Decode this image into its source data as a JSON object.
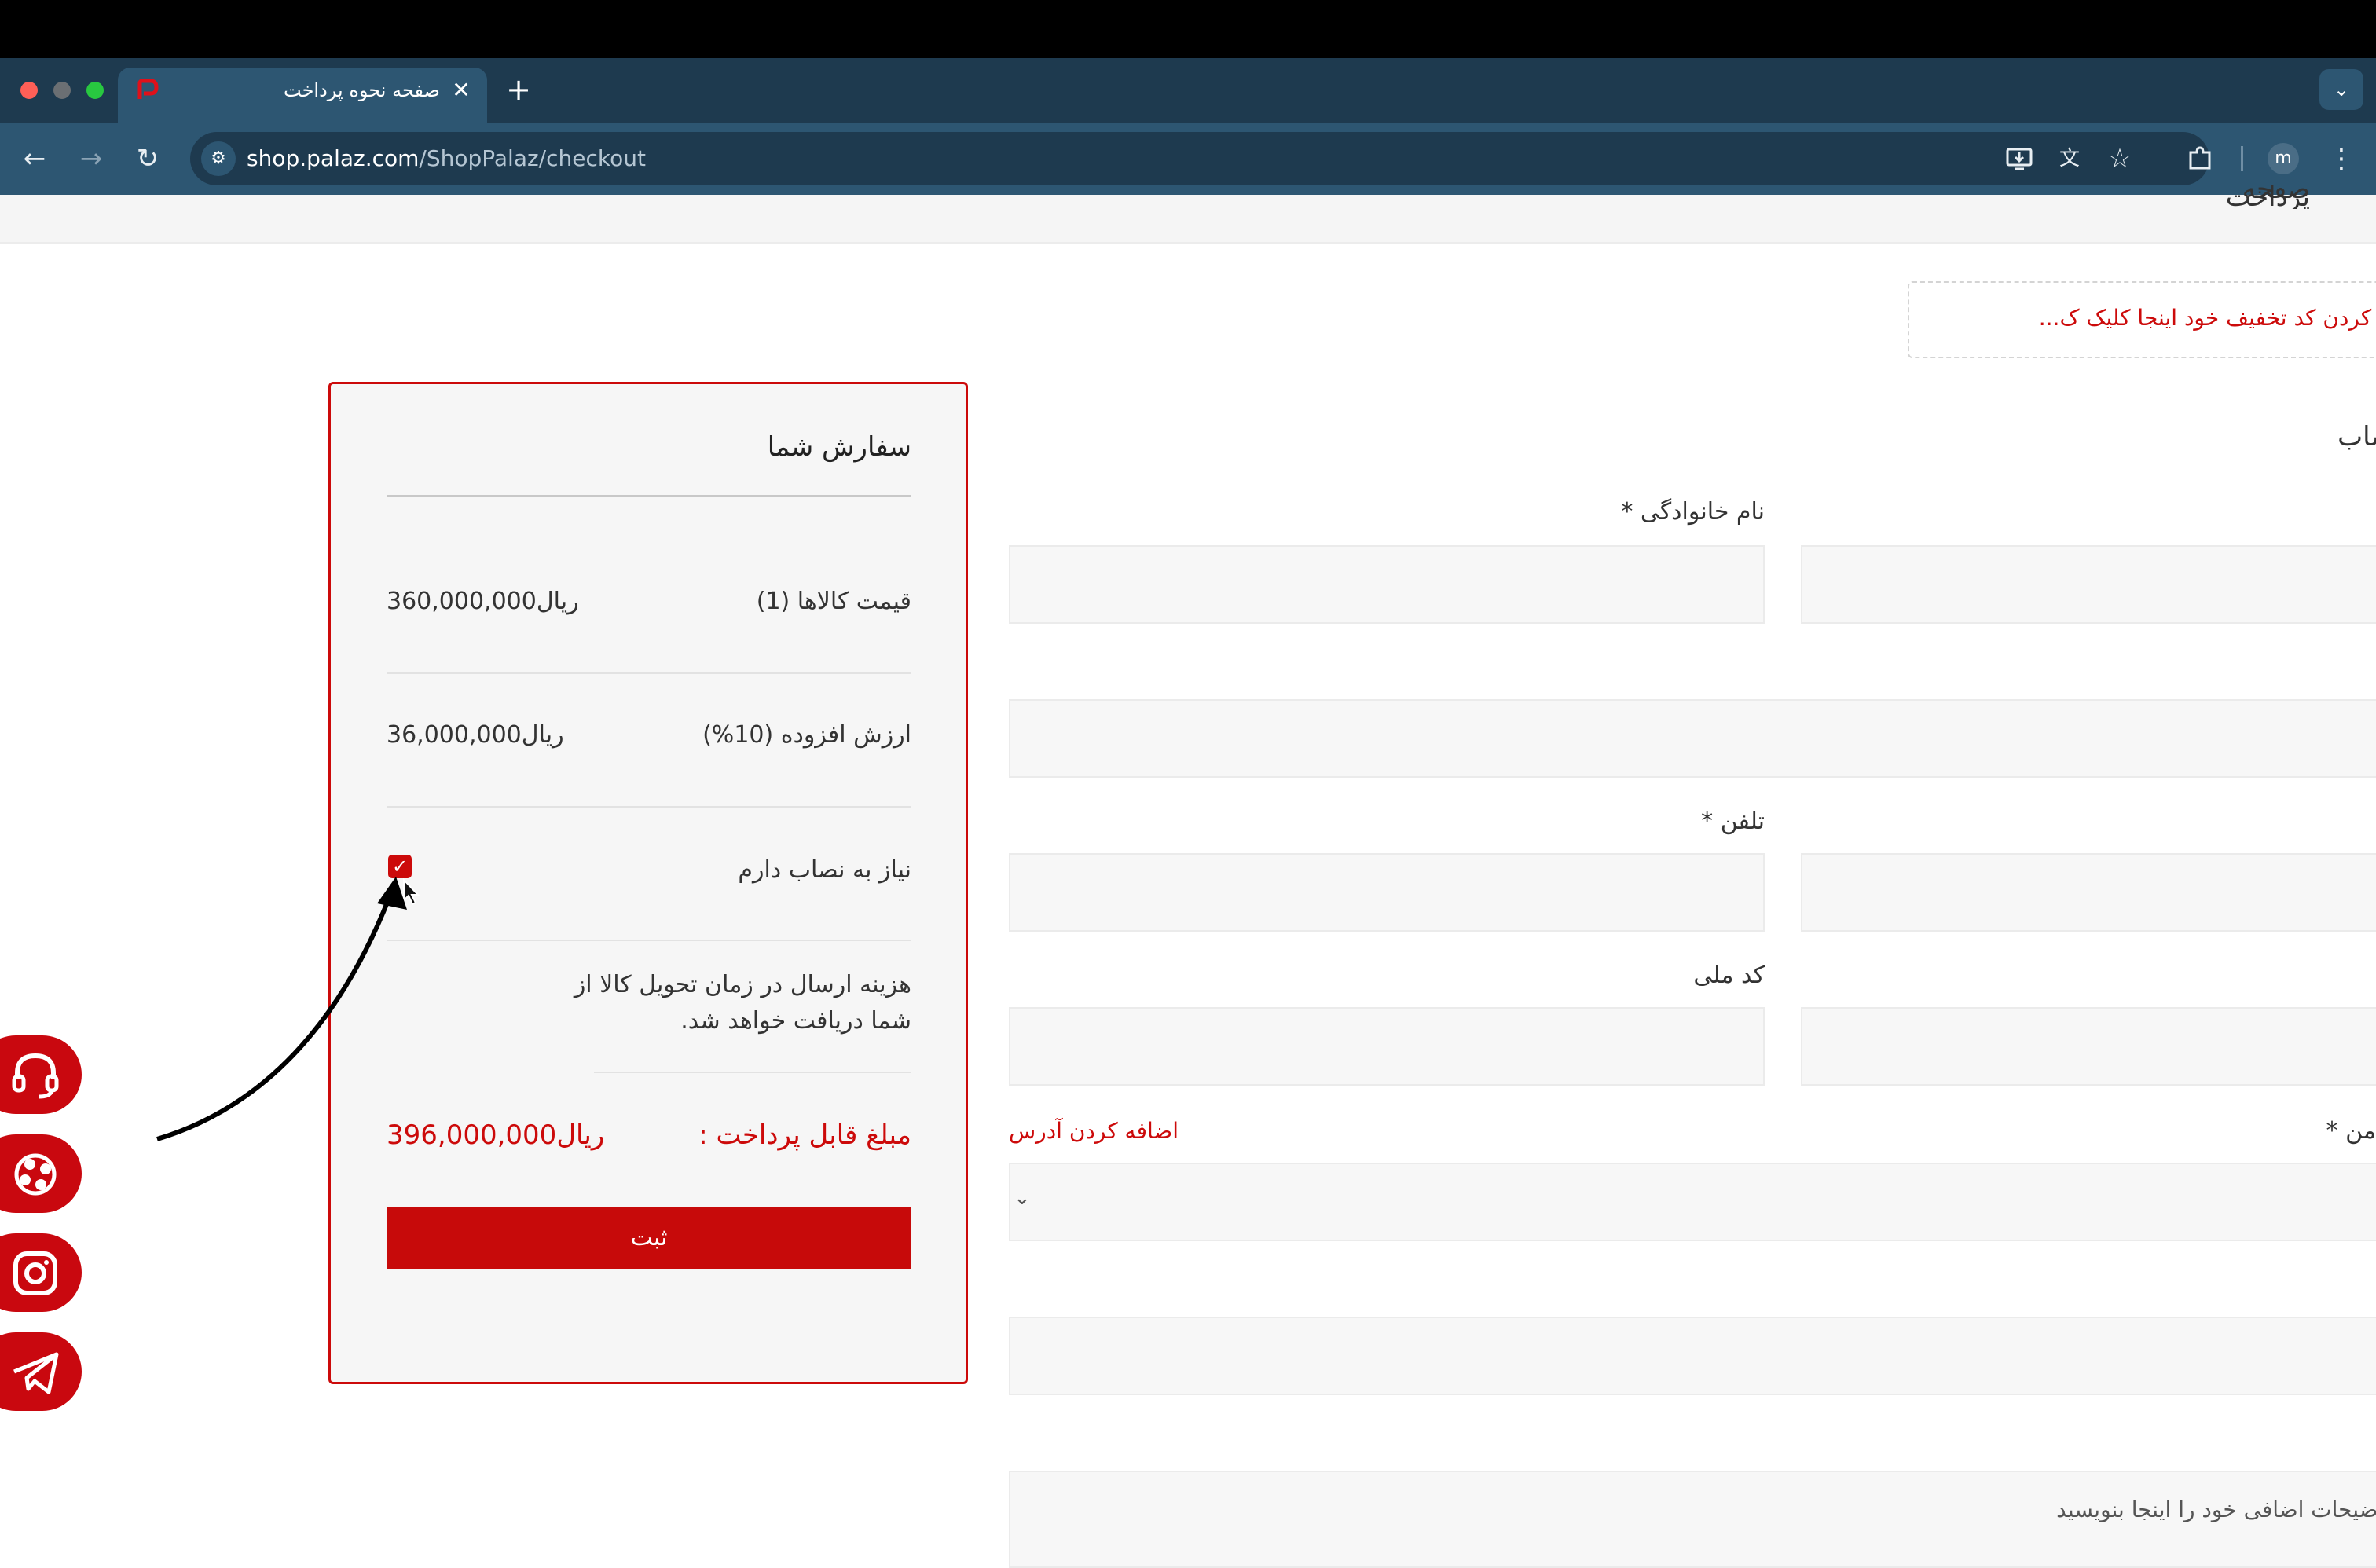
{
  "browser": {
    "tab_title": "صفحه نحوه پرداخت",
    "tab_close": "✕",
    "new_tab": "+",
    "url_host": "shop.palaz.com",
    "url_path": "/ShopPalaz/checkout",
    "profile_initial": "m",
    "icons": [
      "back-icon",
      "forward-icon",
      "reload-icon",
      "site-info-icon",
      "install-app-icon",
      "translate-icon",
      "bookmark-star-icon",
      "extensions-icon",
      "menu-icon",
      "tab-search-icon"
    ]
  },
  "page": {
    "title_partial": "صفحه پرداخت",
    "coupon_prompt": "؟ برای وارد کردن کد تخفیف خود اینجا کلیک ک...",
    "section_heading_partial": "ساب"
  },
  "form": {
    "last_name_label": "نام خانوادگی *",
    "phone_label": "تلفن *",
    "national_code_label": "کد ملی",
    "partial_label_1": ")",
    "address_label_partial": "من *",
    "add_address_link": "اضافه کردن آدرس",
    "notes_placeholder": "وضیحات اضافی خود را اینجا بنویسید",
    "notes_label_partial": "("
  },
  "order": {
    "title": "سفارش شما",
    "items_label": "قیمت کالاها (1)",
    "items_value": "360,000,000ریال",
    "vat_label": "ارزش افزوده (10%)",
    "vat_value": "36,000,000ریال",
    "install_label": "نیاز به نصاب دارم",
    "install_checked": true,
    "shipping_note_line1": "هزینه ارسال در زمان تحویل کالا از",
    "shipping_note_line2": "شما دریافت خواهد شد.",
    "total_label": "مبلغ قابل پرداخت :",
    "total_value": "396,000,000ریال",
    "submit_label": "ثبت"
  },
  "social": [
    "support-headset-icon",
    "aparat-icon",
    "instagram-icon",
    "telegram-icon"
  ],
  "colors": {
    "accent": "#c70a0a",
    "chrome_dark": "#1e3a4f",
    "chrome_toolbar": "#2d5672"
  }
}
